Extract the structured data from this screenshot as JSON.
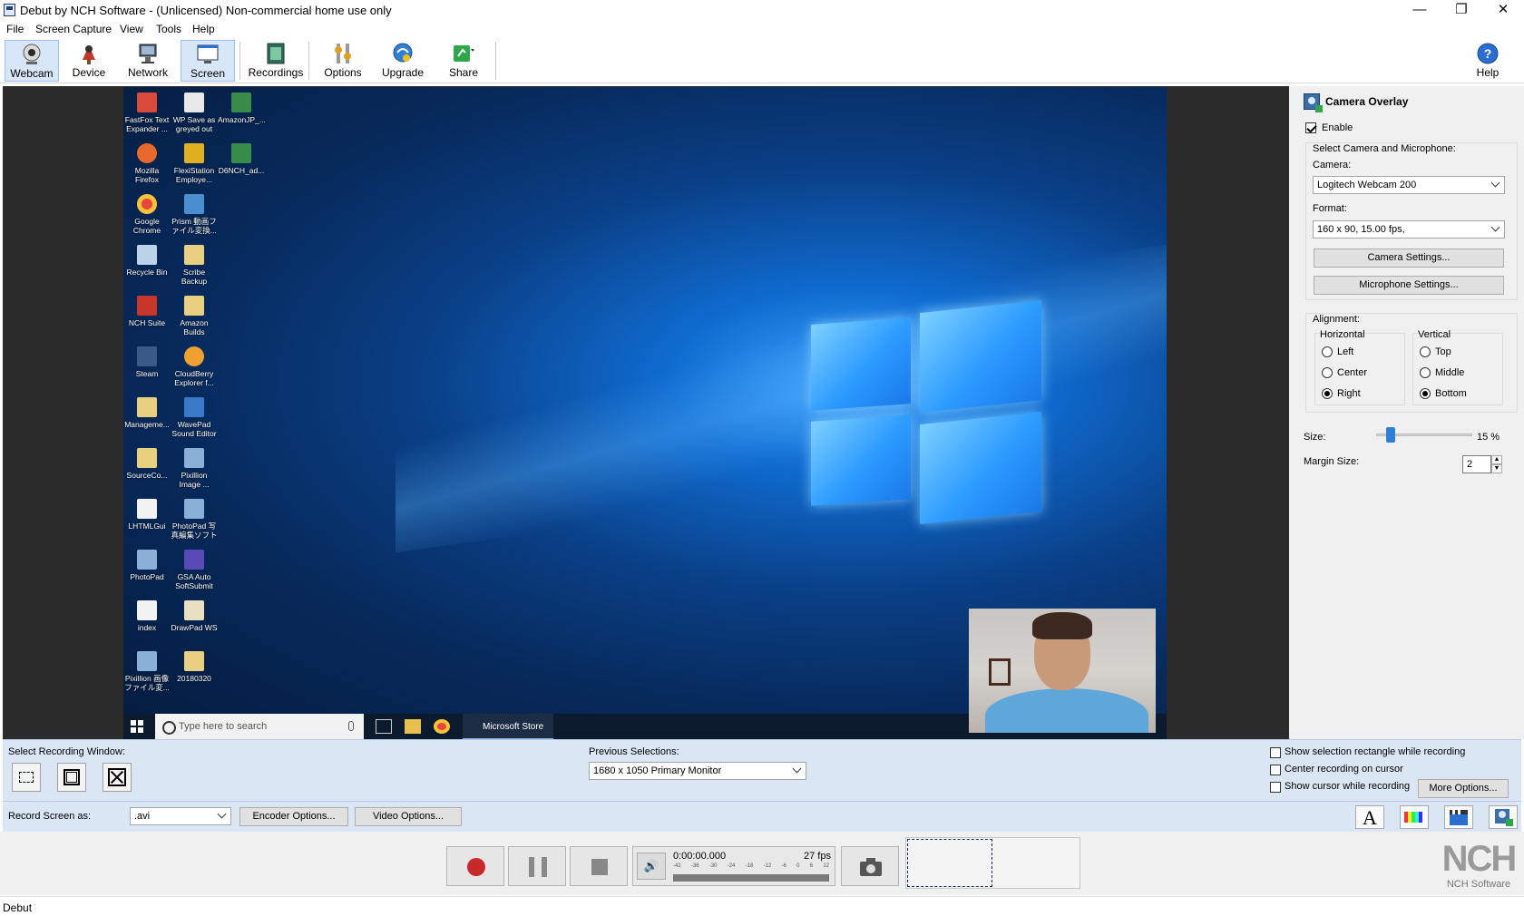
{
  "window": {
    "title": "Debut by NCH Software - (Unlicensed) Non-commercial home use only",
    "minimize": "—",
    "restore": "❐",
    "close": "✕"
  },
  "menu": [
    "File",
    "Screen Capture",
    "View",
    "Tools",
    "Help"
  ],
  "toolbar": {
    "webcam": "Webcam",
    "device": "Device",
    "network": "Network",
    "screen": "Screen",
    "recordings": "Recordings",
    "options": "Options",
    "upgrade": "Upgrade",
    "share": "Share",
    "help": "Help",
    "active": "Screen"
  },
  "desktop": {
    "icons": [
      "FastFox Text Expander ...",
      "WP Save as greyed out",
      "AmazonJP_...",
      "Mozilla Firefox",
      "FlexiStation Employe...",
      "D6NCH_ad...",
      "Google Chrome",
      "Prism 動画ファイル変換...",
      "Recycle Bin",
      "Scribe Backup",
      "NCH Suite",
      "Amazon Builds",
      "Steam",
      "CloudBerry Explorer f...",
      "Manageme...",
      "WavePad Sound Editor",
      "SourceCo...",
      "Pixillion Image ...",
      "LHTMLGui",
      "PhotoPad 写真編集ソフト",
      "PhotoPad",
      "GSA Auto SoftSubmit",
      "index",
      "DrawPad WS",
      "Pixillion 画像ファイル変...",
      "20180320"
    ],
    "search_placeholder": "Type here to search",
    "store_label": "Microsoft Store"
  },
  "camera_overlay": {
    "title": "Camera Overlay",
    "enable_label": "Enable",
    "enabled": true,
    "select_label": "Select Camera and Microphone:",
    "camera_label": "Camera:",
    "camera_value": "Logitech Webcam 200",
    "format_label": "Format:",
    "format_value": "160 x 90, 15.00 fps,",
    "camera_settings": "Camera Settings...",
    "microphone_settings": "Microphone Settings...",
    "alignment_label": "Alignment:",
    "horizontal_label": "Horizontal",
    "vertical_label": "Vertical",
    "horizontal_options": [
      "Left",
      "Center",
      "Right"
    ],
    "horizontal_selected": "Right",
    "vertical_options": [
      "Top",
      "Middle",
      "Bottom"
    ],
    "vertical_selected": "Bottom",
    "size_label": "Size:",
    "size_value": "15 %",
    "size_percent": 15,
    "margin_label": "Margin Size:",
    "margin_value": "2"
  },
  "selection": {
    "window_label": "Select Recording Window:",
    "previous_label": "Previous Selections:",
    "previous_value": "1680 x 1050 Primary Monitor",
    "show_rect_label": "Show selection rectangle while recording",
    "center_label": "Center recording on cursor",
    "show_cursor_label": "Show cursor while recording",
    "more_options": "More Options..."
  },
  "record": {
    "label": "Record Screen as:",
    "format_value": ".avi",
    "encoder_options": "Encoder Options...",
    "video_options": "Video Options..."
  },
  "transport": {
    "time": "0:00:00.000",
    "fps": "27 fps",
    "meter_ticks": [
      "-42",
      "-36",
      "-30",
      "-24",
      "-18",
      "-12",
      "-6",
      "0",
      "6",
      "12"
    ]
  },
  "brand": {
    "logo": "NCH",
    "company": "NCH Software"
  },
  "status": {
    "text": "Debut"
  }
}
